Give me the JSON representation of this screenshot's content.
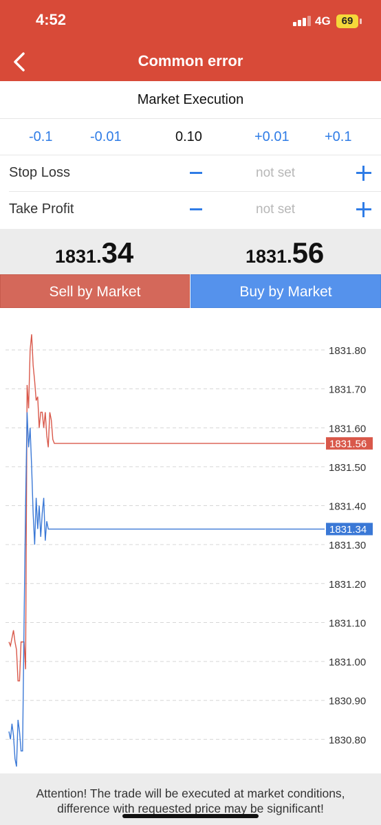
{
  "status_bar": {
    "time": "4:52",
    "network": "4G",
    "battery": "69"
  },
  "header": {
    "title": "Common error",
    "back_icon": "chevron-left-icon"
  },
  "order": {
    "execution_type": "Market Execution",
    "volume_steps": [
      "-0.1",
      "-0.01",
      "+0.01",
      "+0.1"
    ],
    "volume": "0.10",
    "stop_loss": {
      "label": "Stop Loss",
      "value": "not set"
    },
    "take_profit": {
      "label": "Take Profit",
      "value": "not set"
    }
  },
  "prices": {
    "bid_main": "1831.",
    "bid_pips": "34",
    "ask_main": "1831.",
    "ask_pips": "56"
  },
  "actions": {
    "sell_label": "Sell by Market",
    "buy_label": "Buy by Market"
  },
  "colors": {
    "header": "#d84a38",
    "sell": "#d4685a",
    "buy": "#5592ec",
    "accent": "#2f7ce6"
  },
  "chart_data": {
    "type": "line",
    "y_tick_labels": [
      "1831.80",
      "1831.70",
      "1831.60",
      "1831.50",
      "1831.40",
      "1831.30",
      "1831.20",
      "1831.10",
      "1831.00",
      "1830.90",
      "1830.80"
    ],
    "y_ticks": [
      1831.8,
      1831.7,
      1831.6,
      1831.5,
      1831.4,
      1831.3,
      1831.2,
      1831.1,
      1831.0,
      1830.9,
      1830.8
    ],
    "ylim": [
      1830.73,
      1831.86
    ],
    "grid": true,
    "series": [
      {
        "color": "#d9584a",
        "current_label": "1831.56",
        "values": [
          1831.05,
          1831.04,
          1831.06,
          1831.08,
          1831.05,
          1831.03,
          1830.95,
          1830.95,
          1831.05,
          1831.05,
          1831.05,
          1830.98,
          1831.71,
          1831.65,
          1831.8,
          1831.84,
          1831.76,
          1831.72,
          1831.67,
          1831.68,
          1831.6,
          1831.64,
          1831.64,
          1831.6,
          1831.64,
          1831.58,
          1831.55,
          1831.64,
          1831.62,
          1831.57,
          1831.56,
          1831.56,
          1831.56
        ]
      },
      {
        "color": "#3a78d6",
        "current_label": "1831.34",
        "values": [
          1830.82,
          1830.8,
          1830.84,
          1830.81,
          1830.75,
          1830.73,
          1830.85,
          1830.82,
          1830.77,
          1830.77,
          1831.1,
          1831.4,
          1831.64,
          1831.55,
          1831.6,
          1831.5,
          1831.38,
          1831.3,
          1831.42,
          1831.34,
          1831.4,
          1831.32,
          1831.38,
          1831.42,
          1831.31,
          1831.36,
          1831.34,
          1831.34,
          1831.34
        ]
      }
    ]
  },
  "footer": {
    "line1": "Attention! The trade will be executed at market conditions,",
    "line2": "difference with requested price may be significant!"
  }
}
